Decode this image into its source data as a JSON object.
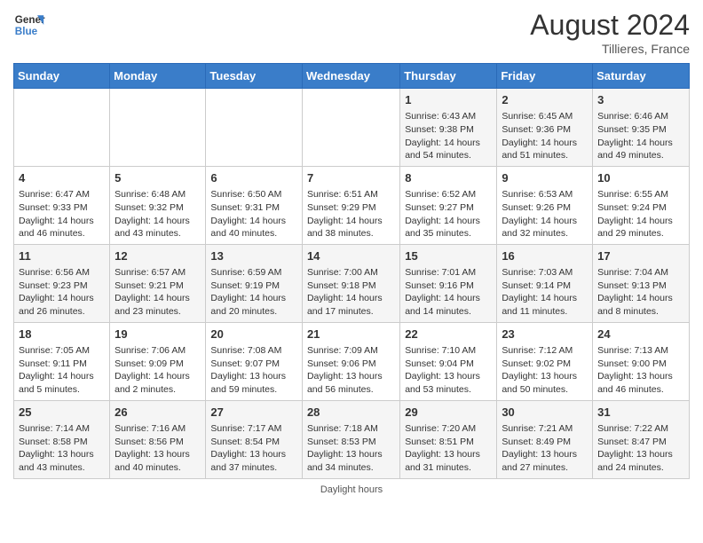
{
  "header": {
    "logo_line1": "General",
    "logo_line2": "Blue",
    "month_year": "August 2024",
    "location": "Tillieres, France"
  },
  "days_of_week": [
    "Sunday",
    "Monday",
    "Tuesday",
    "Wednesday",
    "Thursday",
    "Friday",
    "Saturday"
  ],
  "weeks": [
    [
      {
        "day": "",
        "info": ""
      },
      {
        "day": "",
        "info": ""
      },
      {
        "day": "",
        "info": ""
      },
      {
        "day": "",
        "info": ""
      },
      {
        "day": "1",
        "info": "Sunrise: 6:43 AM\nSunset: 9:38 PM\nDaylight: 14 hours\nand 54 minutes."
      },
      {
        "day": "2",
        "info": "Sunrise: 6:45 AM\nSunset: 9:36 PM\nDaylight: 14 hours\nand 51 minutes."
      },
      {
        "day": "3",
        "info": "Sunrise: 6:46 AM\nSunset: 9:35 PM\nDaylight: 14 hours\nand 49 minutes."
      }
    ],
    [
      {
        "day": "4",
        "info": "Sunrise: 6:47 AM\nSunset: 9:33 PM\nDaylight: 14 hours\nand 46 minutes."
      },
      {
        "day": "5",
        "info": "Sunrise: 6:48 AM\nSunset: 9:32 PM\nDaylight: 14 hours\nand 43 minutes."
      },
      {
        "day": "6",
        "info": "Sunrise: 6:50 AM\nSunset: 9:31 PM\nDaylight: 14 hours\nand 40 minutes."
      },
      {
        "day": "7",
        "info": "Sunrise: 6:51 AM\nSunset: 9:29 PM\nDaylight: 14 hours\nand 38 minutes."
      },
      {
        "day": "8",
        "info": "Sunrise: 6:52 AM\nSunset: 9:27 PM\nDaylight: 14 hours\nand 35 minutes."
      },
      {
        "day": "9",
        "info": "Sunrise: 6:53 AM\nSunset: 9:26 PM\nDaylight: 14 hours\nand 32 minutes."
      },
      {
        "day": "10",
        "info": "Sunrise: 6:55 AM\nSunset: 9:24 PM\nDaylight: 14 hours\nand 29 minutes."
      }
    ],
    [
      {
        "day": "11",
        "info": "Sunrise: 6:56 AM\nSunset: 9:23 PM\nDaylight: 14 hours\nand 26 minutes."
      },
      {
        "day": "12",
        "info": "Sunrise: 6:57 AM\nSunset: 9:21 PM\nDaylight: 14 hours\nand 23 minutes."
      },
      {
        "day": "13",
        "info": "Sunrise: 6:59 AM\nSunset: 9:19 PM\nDaylight: 14 hours\nand 20 minutes."
      },
      {
        "day": "14",
        "info": "Sunrise: 7:00 AM\nSunset: 9:18 PM\nDaylight: 14 hours\nand 17 minutes."
      },
      {
        "day": "15",
        "info": "Sunrise: 7:01 AM\nSunset: 9:16 PM\nDaylight: 14 hours\nand 14 minutes."
      },
      {
        "day": "16",
        "info": "Sunrise: 7:03 AM\nSunset: 9:14 PM\nDaylight: 14 hours\nand 11 minutes."
      },
      {
        "day": "17",
        "info": "Sunrise: 7:04 AM\nSunset: 9:13 PM\nDaylight: 14 hours\nand 8 minutes."
      }
    ],
    [
      {
        "day": "18",
        "info": "Sunrise: 7:05 AM\nSunset: 9:11 PM\nDaylight: 14 hours\nand 5 minutes."
      },
      {
        "day": "19",
        "info": "Sunrise: 7:06 AM\nSunset: 9:09 PM\nDaylight: 14 hours\nand 2 minutes."
      },
      {
        "day": "20",
        "info": "Sunrise: 7:08 AM\nSunset: 9:07 PM\nDaylight: 13 hours\nand 59 minutes."
      },
      {
        "day": "21",
        "info": "Sunrise: 7:09 AM\nSunset: 9:06 PM\nDaylight: 13 hours\nand 56 minutes."
      },
      {
        "day": "22",
        "info": "Sunrise: 7:10 AM\nSunset: 9:04 PM\nDaylight: 13 hours\nand 53 minutes."
      },
      {
        "day": "23",
        "info": "Sunrise: 7:12 AM\nSunset: 9:02 PM\nDaylight: 13 hours\nand 50 minutes."
      },
      {
        "day": "24",
        "info": "Sunrise: 7:13 AM\nSunset: 9:00 PM\nDaylight: 13 hours\nand 46 minutes."
      }
    ],
    [
      {
        "day": "25",
        "info": "Sunrise: 7:14 AM\nSunset: 8:58 PM\nDaylight: 13 hours\nand 43 minutes."
      },
      {
        "day": "26",
        "info": "Sunrise: 7:16 AM\nSunset: 8:56 PM\nDaylight: 13 hours\nand 40 minutes."
      },
      {
        "day": "27",
        "info": "Sunrise: 7:17 AM\nSunset: 8:54 PM\nDaylight: 13 hours\nand 37 minutes."
      },
      {
        "day": "28",
        "info": "Sunrise: 7:18 AM\nSunset: 8:53 PM\nDaylight: 13 hours\nand 34 minutes."
      },
      {
        "day": "29",
        "info": "Sunrise: 7:20 AM\nSunset: 8:51 PM\nDaylight: 13 hours\nand 31 minutes."
      },
      {
        "day": "30",
        "info": "Sunrise: 7:21 AM\nSunset: 8:49 PM\nDaylight: 13 hours\nand 27 minutes."
      },
      {
        "day": "31",
        "info": "Sunrise: 7:22 AM\nSunset: 8:47 PM\nDaylight: 13 hours\nand 24 minutes."
      }
    ]
  ],
  "footer": {
    "daylight_hours_label": "Daylight hours"
  }
}
